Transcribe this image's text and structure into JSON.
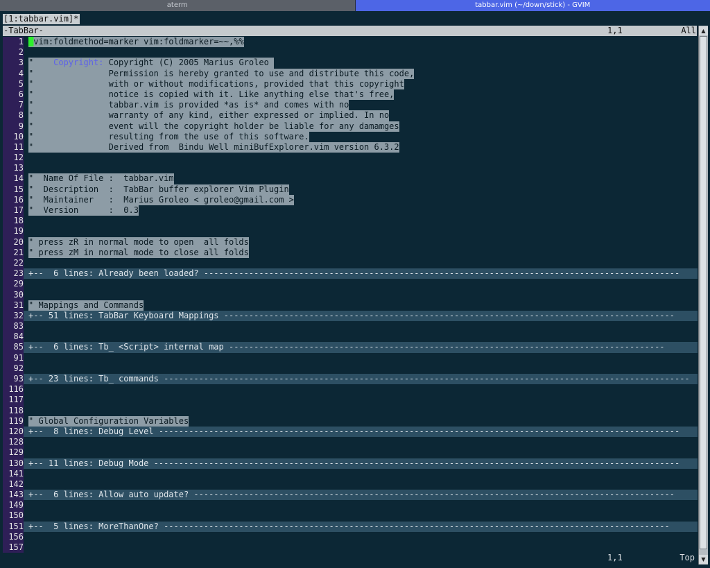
{
  "wm_tabs": [
    {
      "label": "aterm"
    },
    {
      "label": "tabbar.vim (~/down/stick) - GVIM"
    }
  ],
  "buffer_tabs": "[1:tabbar.vim]*",
  "tabbar_status": {
    "name": "-TabBar-",
    "position": "1,1",
    "percent": "All"
  },
  "lines": [
    {
      "n": "1",
      "t": "vim:foldmethod=marker vim:foldmarker=~~,%%",
      "cursor": true
    },
    {
      "n": "2",
      "t": ""
    },
    {
      "n": "3",
      "kw": "Copyright:",
      "pre": "\"    ",
      "t": " Copyright (C) 2005 Marius Groleo "
    },
    {
      "n": "4",
      "t": "\"               Permission is hereby granted to use and distribute this code,"
    },
    {
      "n": "5",
      "t": "\"               with or without modifications, provided that this copyright"
    },
    {
      "n": "6",
      "t": "\"               notice is copied with it. Like anything else that's free,"
    },
    {
      "n": "7",
      "t": "\"               tabbar.vim is provided *as is* and comes with no"
    },
    {
      "n": "8",
      "t": "\"               warranty of any kind, either expressed or implied. In no"
    },
    {
      "n": "9",
      "t": "\"               event will the copyright holder be liable for any damamges"
    },
    {
      "n": "10",
      "t": "\"               resulting from the use of this software."
    },
    {
      "n": "11",
      "t": "\"               Derived from  Bindu Well miniBufExplorer.vim version 6.3.2"
    },
    {
      "n": "12",
      "t": ""
    },
    {
      "n": "13",
      "t": ""
    },
    {
      "n": "14",
      "t": "\"  Name Of File :  tabbar.vim"
    },
    {
      "n": "15",
      "t": "\"  Description  :  TabBar buffer explorer Vim Plugin"
    },
    {
      "n": "16",
      "t": "\"  Maintainer   :  Marius Groleo < groleo@gmail.com >"
    },
    {
      "n": "17",
      "t": "\"  Version      :  0.3"
    },
    {
      "n": "18",
      "t": ""
    },
    {
      "n": "19",
      "t": ""
    },
    {
      "n": "20",
      "t": "\" press zR in normal mode to open  all folds"
    },
    {
      "n": "21",
      "t": "\" press zM in normal mode to close all folds"
    },
    {
      "n": "22",
      "t": ""
    },
    {
      "n": "23",
      "fold": true,
      "t": "+--  6 lines: Already been loaded? -----------------------------------------------------------------------------------------------"
    },
    {
      "n": "29",
      "t": ""
    },
    {
      "n": "30",
      "t": ""
    },
    {
      "n": "31",
      "t": "\" Mappings and Commands"
    },
    {
      "n": "32",
      "fold": true,
      "t": "+-- 51 lines: TabBar Keyboard Mappings ------------------------------------------------------------------------------------------"
    },
    {
      "n": "83",
      "t": ""
    },
    {
      "n": "84",
      "t": ""
    },
    {
      "n": "85",
      "fold": true,
      "t": "+--  6 lines: Tb_ <Script> internal map ---------------------------------------------------------------------------------------"
    },
    {
      "n": "91",
      "t": ""
    },
    {
      "n": "92",
      "t": ""
    },
    {
      "n": "93",
      "fold": true,
      "t": "+-- 23 lines: Tb_ commands ---------------------------------------------------------------------------------------------------------"
    },
    {
      "n": "116",
      "t": ""
    },
    {
      "n": "117",
      "t": ""
    },
    {
      "n": "118",
      "t": ""
    },
    {
      "n": "119",
      "t": "\" Global Configuration Variables"
    },
    {
      "n": "120",
      "fold": true,
      "t": "+--  8 lines: Debug Level --------------------------------------------------------------------------------------------------------"
    },
    {
      "n": "128",
      "t": ""
    },
    {
      "n": "129",
      "t": ""
    },
    {
      "n": "130",
      "fold": true,
      "t": "+-- 11 lines: Debug Mode ---------------------------------------------------------------------------------------------------------"
    },
    {
      "n": "141",
      "t": ""
    },
    {
      "n": "142",
      "t": ""
    },
    {
      "n": "143",
      "fold": true,
      "t": "+--  6 lines: Allow auto update? ------------------------------------------------------------------------------------------------"
    },
    {
      "n": "149",
      "t": ""
    },
    {
      "n": "150",
      "t": ""
    },
    {
      "n": "151",
      "fold": true,
      "t": "+--  5 lines: MoreThanOne? -----------------------------------------------------------------------------------------------------"
    },
    {
      "n": "156",
      "t": ""
    },
    {
      "n": "157",
      "t": ""
    }
  ],
  "bottom_status": {
    "position": "1,1",
    "percent": "Top"
  },
  "colors": {
    "background": "#0c2735",
    "line_number_bg": "#2e1f57",
    "fold_bg": "#2d4f63",
    "active_tab": "#4d66e6",
    "cursor": "#2cf02c"
  }
}
